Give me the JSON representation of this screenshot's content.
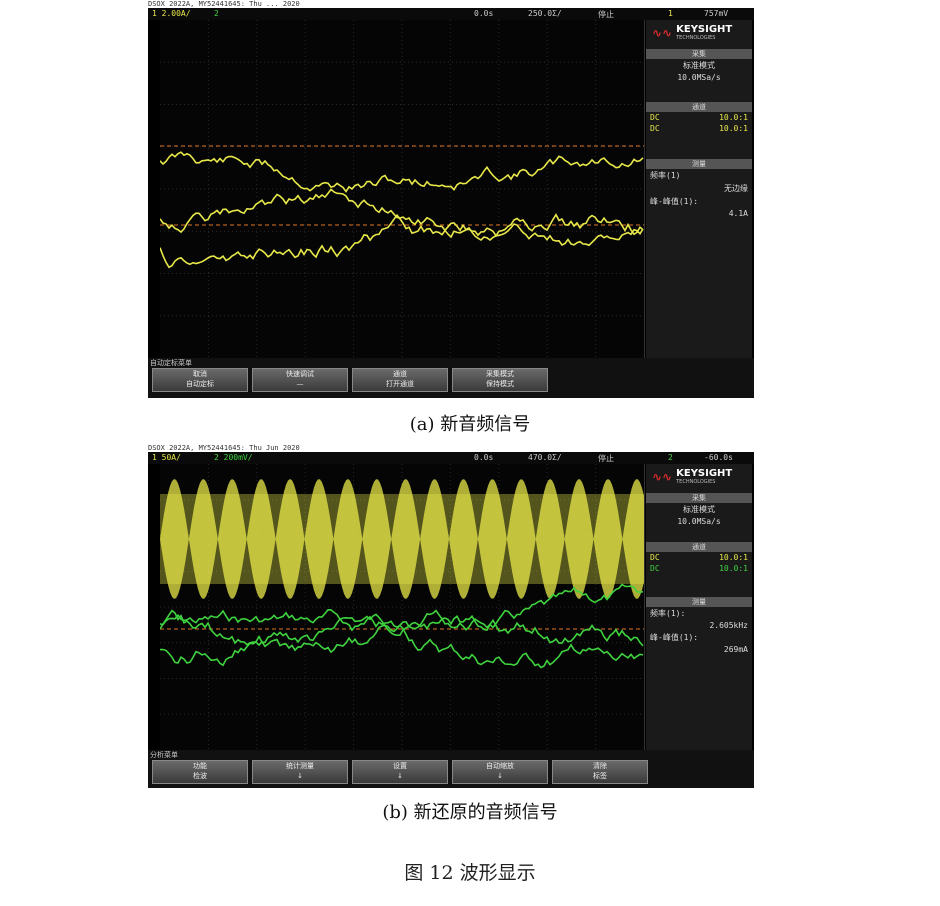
{
  "panel_a": {
    "status_line": "DSOX 2022A, MY52441645: Thu ... 2020",
    "ch1_scale": "1  2.00A/",
    "ch2_label": "2",
    "delay": "0.0s",
    "timebase": "250.0Σ/",
    "stop_label": "停止",
    "trig_channel": "1",
    "trig_level": "757mV",
    "logo_brand": "KEYSIGHT",
    "logo_sub": "TECHNOLOGIES",
    "sec_acq": "采集",
    "acq_mode": "标准模式",
    "acq_rate": "10.0MSa/s",
    "sec_channel": "通道",
    "ch_rows": [
      {
        "coupling": "DC",
        "value": "10.0:1"
      },
      {
        "coupling": "DC",
        "value": "10.0:1"
      }
    ],
    "sec_measure": "测量",
    "meas1_label": "频率(1)",
    "meas1_value": "无边缘",
    "meas2_label": "峰-峰值(1):",
    "meas2_value": "4.1A",
    "softkey_menu_title": "自动定标菜单",
    "softkeys": [
      "取消\n自动定标",
      "快速调试\n—",
      "通道\n打开通道",
      "采集模式\n保持模式"
    ],
    "caption": "(a) 新音频信号"
  },
  "panel_b": {
    "status_line": "DSOX 2022A, MY52441645: Thu Jun 2020",
    "ch1_scale": "1  50A/",
    "ch2_scale": "2  200mV/",
    "delay": "0.0s",
    "timebase": "470.0Σ/",
    "stop_label": "停止",
    "trig_channel": "2",
    "trig_level": "-60.0s",
    "logo_brand": "KEYSIGHT",
    "logo_sub": "TECHNOLOGIES",
    "sec_acq": "采集",
    "acq_mode": "标准模式",
    "acq_rate": "10.0MSa/s",
    "sec_channel": "通道",
    "ch_rows": [
      {
        "coupling": "DC",
        "value": "10.0:1"
      },
      {
        "coupling": "DC",
        "value": "10.0:1"
      }
    ],
    "sec_measure": "测量",
    "meas1_label": "频率(1):",
    "meas1_value": "2.605kHz",
    "meas2_label": "峰-峰值(1):",
    "meas2_value": "269mA",
    "softkey_menu_title": "分析菜单",
    "softkeys": [
      "功能\n检波",
      "统计测量\n↓",
      "设置\n↓",
      "自动缩放\n↓",
      "清除\n标签"
    ],
    "caption": "(b) 新还原的音频信号"
  },
  "figure_caption": "图 12    波形显示",
  "colors": {
    "ch1": "#e8e84a",
    "ch2": "#3fd33f",
    "trigger": "#e0782a",
    "background": "#000000"
  }
}
